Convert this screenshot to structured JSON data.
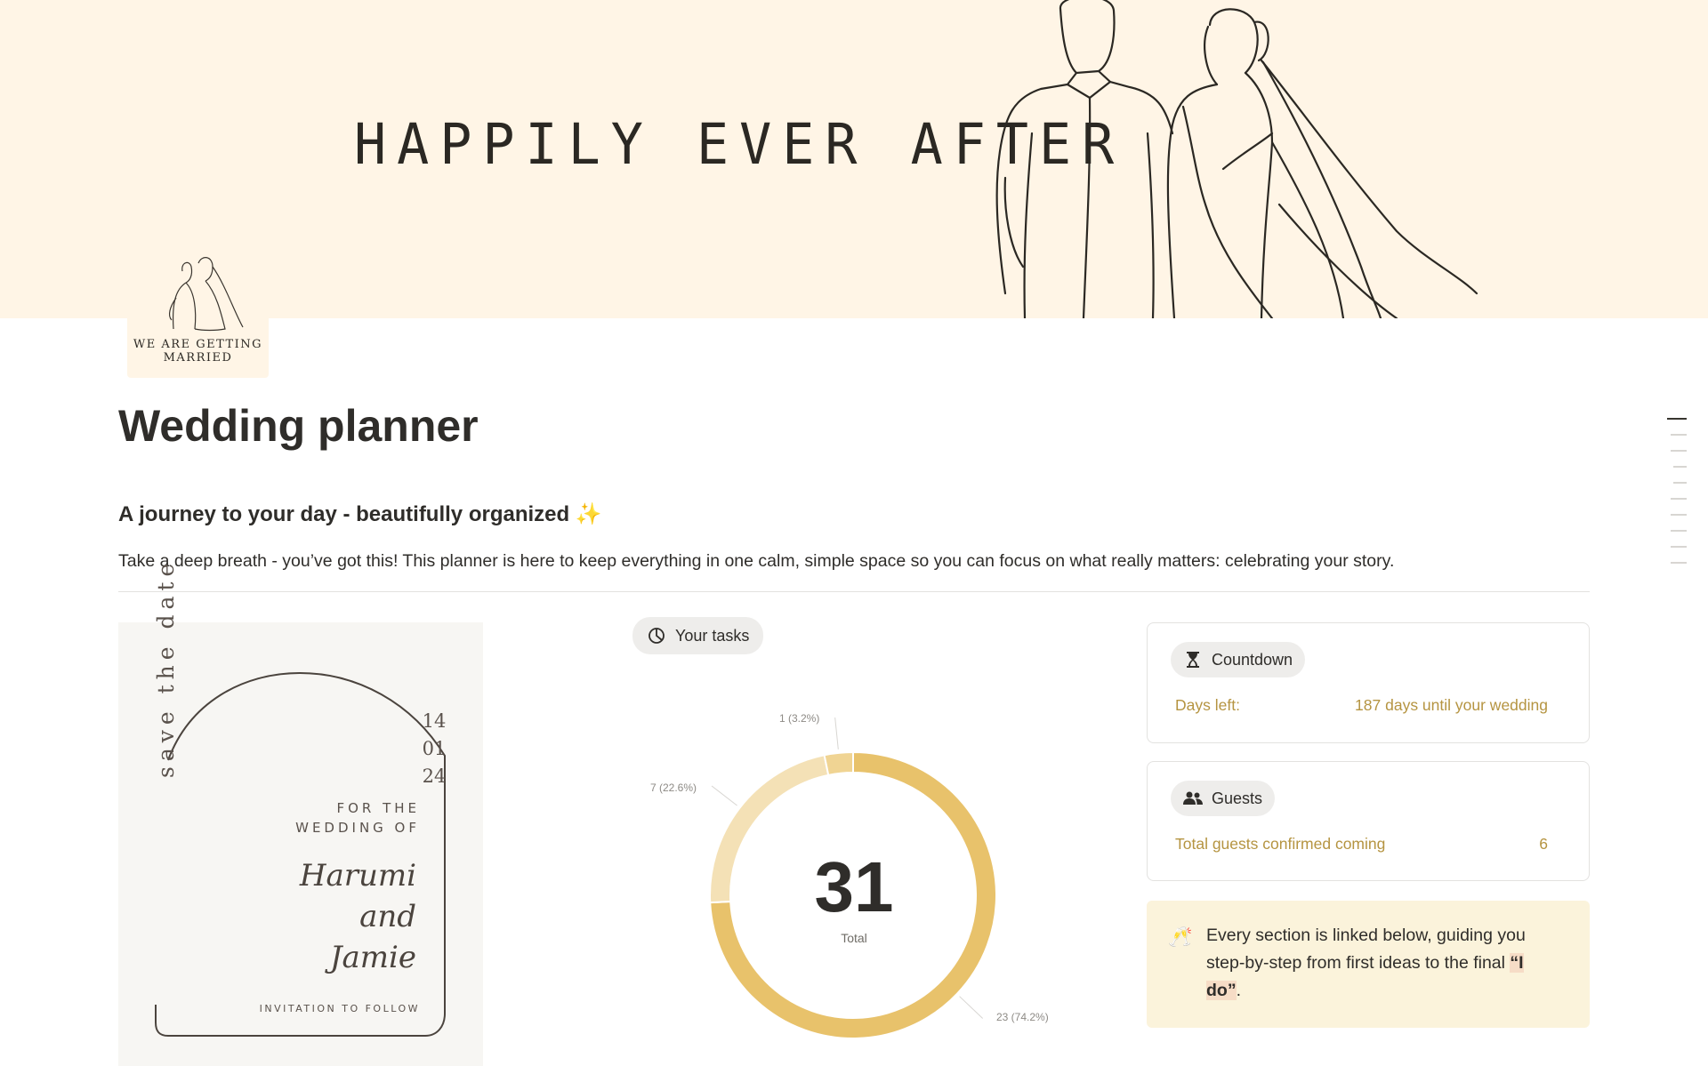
{
  "cover": {
    "title": "HAPPILY EVER AFTER",
    "icon_text_line1": "WE ARE GETTING",
    "icon_text_line2": "MARRIED"
  },
  "page": {
    "title": "Wedding planner",
    "subtitle": "A journey to your day - beautifully organized ✨",
    "intro": "Take a deep breath - you’ve got this! This planner is here to keep everything in one calm, simple space so you can focus on what really matters: celebrating your story."
  },
  "invitation": {
    "save_the_date": "save the date",
    "date_day": "14",
    "date_month": "01",
    "date_year": "24",
    "for_line1": "FOR THE",
    "for_line2": "WEDDING OF",
    "name1": "Harumi",
    "and": "and",
    "name2": "Jamie",
    "follow": "INVITATION TO FOLLOW"
  },
  "tasks": {
    "chip_label": "Your tasks",
    "chip_icon": "pie-chart-icon",
    "total": "31",
    "total_label": "Total"
  },
  "chart_data": {
    "type": "pie",
    "variant": "donut",
    "total": 31,
    "slices": [
      {
        "value": 23,
        "label": "23 (74.2%)",
        "color": "#e8c26b"
      },
      {
        "value": 7,
        "label": "7 (22.6%)",
        "color": "#f4e1b6"
      },
      {
        "value": 1,
        "label": "1 (3.2%)",
        "color": "#f0d493"
      }
    ]
  },
  "countdown": {
    "chip_label": "Countdown",
    "chip_icon": "hourglass-icon",
    "row_label": "Days left:",
    "row_value": "187 days until your wedding"
  },
  "guests": {
    "chip_label": "Guests",
    "chip_icon": "people-icon",
    "row_label": "Total guests confirmed coming",
    "row_value": "6"
  },
  "callout": {
    "icon": "🥂",
    "text_before": "Every section is linked below, guiding you step-by-step from first ideas to the final ",
    "text_bold": "“I do”",
    "text_after": "."
  },
  "colors": {
    "cover_bg": "#fff5e6",
    "accent_gold": "#b59441",
    "callout_bg": "#fbf3db"
  }
}
